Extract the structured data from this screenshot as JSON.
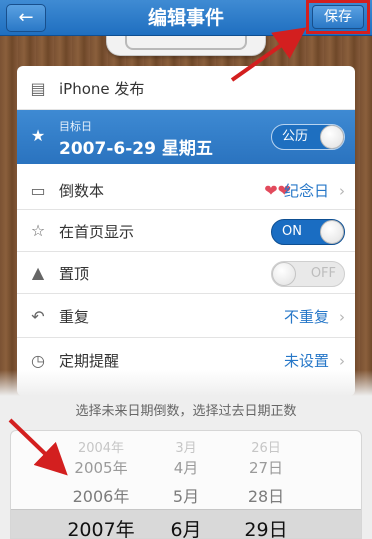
{
  "header": {
    "title": "编辑事件",
    "back_icon": "left-arrow",
    "save_label": "保存"
  },
  "event": {
    "name": "iPhone 发布",
    "target_date_label": "目标日",
    "target_date": "2007-6-29 星期五",
    "calendar_toggle_label": "公历",
    "calendar_toggle_on": true
  },
  "rows": {
    "book_label": "倒数本",
    "book_value": "纪念日",
    "homepage_label": "在首页显示",
    "homepage_toggle_label": "ON",
    "homepage_on": true,
    "pin_label": "置顶",
    "pin_toggle_label": "OFF",
    "pin_on": false,
    "repeat_label": "重复",
    "repeat_value": "不重复",
    "reminder_label": "定期提醒",
    "reminder_value": "未设置"
  },
  "hint": "选择未来日期倒数，选择过去日期正数",
  "picker": {
    "years": [
      "2004年",
      "2005年",
      "2006年",
      "2007年"
    ],
    "months": [
      "3月",
      "4月",
      "5月",
      "6月"
    ],
    "days": [
      "26日",
      "27日",
      "28日",
      "29日"
    ],
    "selected": {
      "year": "2007年",
      "month": "6月",
      "day": "29日"
    }
  },
  "colors": {
    "accent": "#2a73bf",
    "annotation": "#d31f1f",
    "link": "#2677c8"
  }
}
